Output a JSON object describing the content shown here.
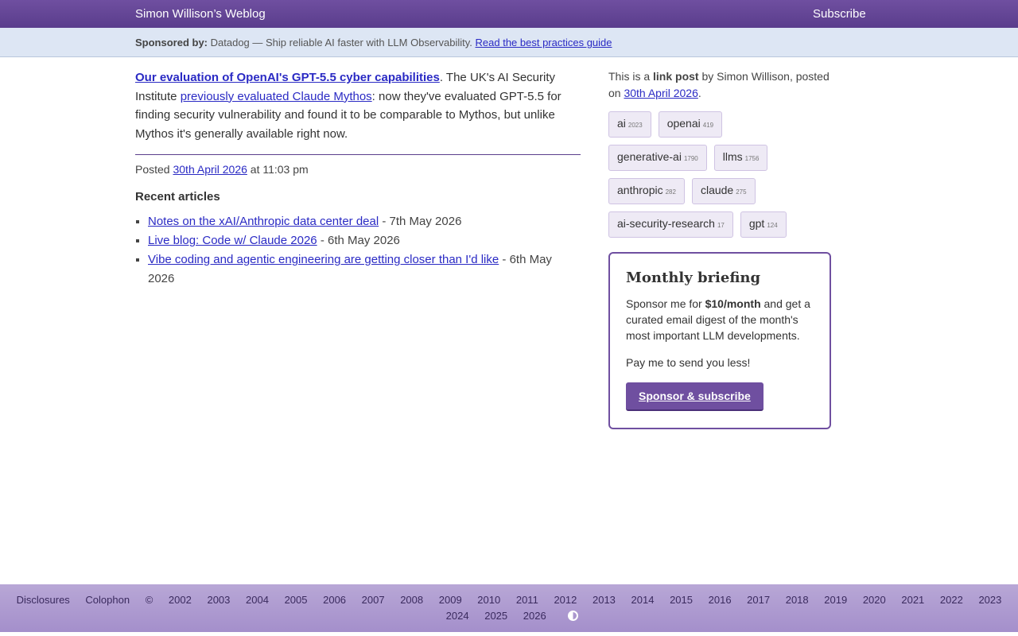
{
  "header": {
    "site_title": "Simon Willison’s Weblog",
    "subscribe": "Subscribe"
  },
  "sponsor": {
    "label": "Sponsored by:",
    "text": "Datadog — Ship reliable AI faster with LLM Observability.",
    "link": "Read the best practices guide"
  },
  "entry": {
    "title": "Our evaluation of OpenAI's GPT-5.5 cyber capabilities",
    "text_a": ". The UK's AI Security Institute ",
    "link_b": "previously evaluated Claude Mythos",
    "text_c": ": now they've evaluated GPT-5.5 for finding security vulnerability and found it to be comparable to Mythos, but unlike Mythos it's generally available right now.",
    "posted_prefix": "Posted ",
    "posted_date": "30th April 2026",
    "posted_suffix": " at 11:03 pm"
  },
  "recent": {
    "heading": "Recent articles",
    "items": [
      {
        "title": "Notes on the xAI/Anthropic data center deal",
        "date": " - 7th May 2026"
      },
      {
        "title": "Live blog: Code w/ Claude 2026",
        "date": " - 6th May 2026"
      },
      {
        "title": "Vibe coding and agentic engineering are getting closer than I'd like",
        "date": " - 6th May 2026"
      }
    ]
  },
  "sidebar": {
    "meta_a": "This is a ",
    "meta_b": "link post",
    "meta_c": " by Simon Willison, posted on ",
    "meta_date": "30th April 2026",
    "meta_end": ".",
    "tags": [
      {
        "name": "ai",
        "count": "2023"
      },
      {
        "name": "openai",
        "count": "419"
      },
      {
        "name": "generative-ai",
        "count": "1790"
      },
      {
        "name": "llms",
        "count": "1756"
      },
      {
        "name": "anthropic",
        "count": "282"
      },
      {
        "name": "claude",
        "count": "275"
      },
      {
        "name": "ai-security-research",
        "count": "17"
      },
      {
        "name": "gpt",
        "count": "124"
      }
    ]
  },
  "briefing": {
    "title": "Monthly briefing",
    "body_a": "Sponsor me for ",
    "body_b": "$10/month",
    "body_c": " and get a curated email digest of the month's most important LLM developments.",
    "pay": "Pay me to send you less!",
    "button": "Sponsor & subscribe"
  },
  "footer": {
    "disclosures": "Disclosures",
    "colophon": "Colophon",
    "copyright": "©",
    "years_row1": [
      "2002",
      "2003",
      "2004",
      "2005",
      "2006",
      "2007",
      "2008",
      "2009",
      "2010",
      "2011",
      "2012",
      "2013",
      "2014",
      "2015",
      "2016",
      "2017",
      "2018",
      "2019",
      "2020",
      "2021",
      "2022",
      "2023"
    ],
    "years_row2": [
      "2024",
      "2025",
      "2026"
    ]
  }
}
